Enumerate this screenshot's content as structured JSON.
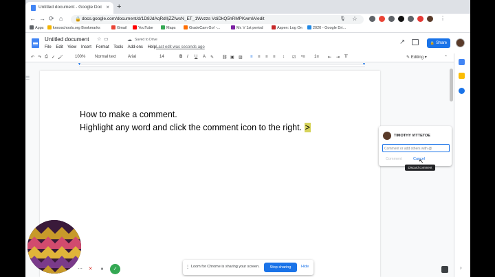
{
  "browser": {
    "tab_title": "Untitled document - Google Docs",
    "tab_close": "×",
    "new_tab": "+",
    "url": "docs.google.com/document/d/1D8JdAqRdlIjZZfwsN_ET_1Wvzzs VdiDkQ5hRMPKwmlA/edit",
    "nav": {
      "back": "←",
      "forward": "→",
      "reload": "⟳",
      "home": "⌂",
      "lock": "🔒",
      "mic": "🎙",
      "star": "☆"
    }
  },
  "bookmarks": [
    {
      "label": "Apps",
      "color": "#5f6368"
    },
    {
      "label": "knoxschools.org Bookmarks",
      "color": "#f4b400"
    },
    {
      "label": "Gmail",
      "color": "#ea4335"
    },
    {
      "label": "YouTube",
      "color": "#ff0000"
    },
    {
      "label": "Maps",
      "color": "#34a853"
    },
    {
      "label": "GradeCam Go! -...",
      "color": "#ff6d00"
    },
    {
      "label": "Mr. V 1st period",
      "color": "#7b1fa2"
    },
    {
      "label": "Aspen: Log On",
      "color": "#c62828"
    },
    {
      "label": "2020 - Google Dri...",
      "color": "#1e88e5"
    }
  ],
  "docs": {
    "title": "Untitled document",
    "saved": "Saved to Drive",
    "menus": [
      "File",
      "Edit",
      "View",
      "Insert",
      "Format",
      "Tools",
      "Add-ons",
      "Help"
    ],
    "last_edit": "Last edit was seconds ago",
    "share_label": "Share",
    "share_icon": "🔒"
  },
  "format_toolbar": {
    "zoom": "100%",
    "style": "Normal text",
    "font": "Arial",
    "size": "14",
    "mode": "Editing"
  },
  "document": {
    "line1": "How to make a comment.",
    "line2": "Highlight any word and click the comment icon to the right.",
    "highlighted": ">"
  },
  "comment": {
    "author": "TIMOTHY VITTETOE",
    "placeholder": "Comment or add others with @",
    "comment_button": "Comment",
    "cancel_button": "Cancel",
    "tooltip": "Discard comment"
  },
  "loom": {
    "message": "Loom for Chrome is sharing your screen.",
    "stop_button": "Stop sharing",
    "hide_button": "Hide"
  },
  "colors": {
    "accent": "#1a73e8",
    "highlight": "#d6d35a"
  }
}
